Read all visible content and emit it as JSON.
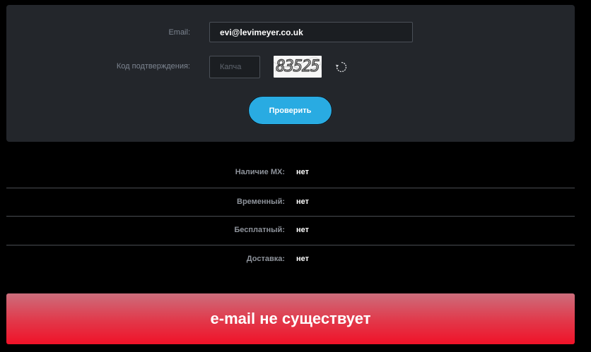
{
  "form": {
    "email_label": "Email:",
    "email_value": "evi@levimeyer.co.uk",
    "code_label": "Код подтверждения:",
    "captcha_placeholder": "Капча",
    "captcha_image_text": "83525",
    "refresh_icon": "refresh-icon",
    "check_button": "Проверить"
  },
  "results": [
    {
      "label": "Наличие MX:",
      "value": "нет"
    },
    {
      "label": "Временный:",
      "value": "нет"
    },
    {
      "label": "Бесплатный:",
      "value": "нет"
    },
    {
      "label": "Доставка:",
      "value": "нет"
    }
  ],
  "status": {
    "text": "e-mail не существует",
    "color": "#f01228"
  },
  "colors": {
    "panel_bg": "#23262b",
    "accent": "#29abe2",
    "page_bg": "#000000"
  }
}
